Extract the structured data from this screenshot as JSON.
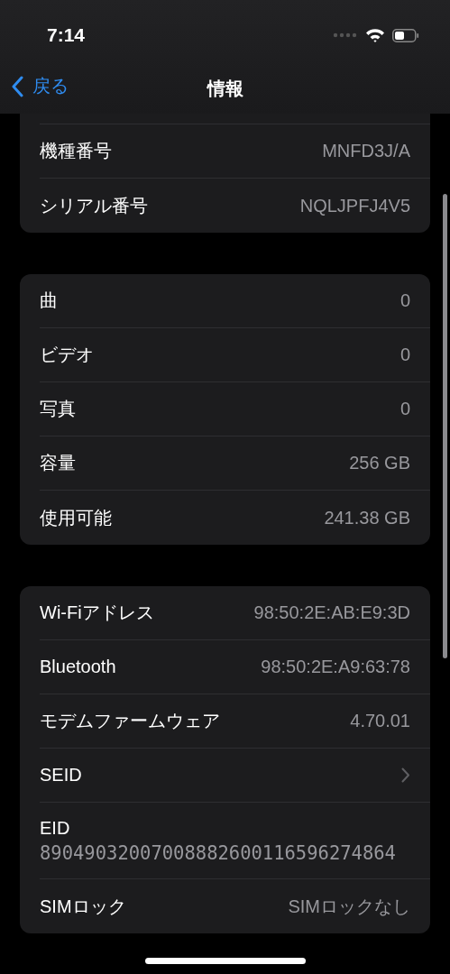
{
  "status_bar": {
    "time": "7:14"
  },
  "nav": {
    "back": "戻る",
    "title": "情報"
  },
  "groups": [
    {
      "clipped_top": true,
      "rows": [
        {
          "kind": "value",
          "label": "機種番号",
          "value": "MNFD3J/A"
        },
        {
          "kind": "value",
          "label": "シリアル番号",
          "value": "NQLJPFJ4V5"
        }
      ]
    },
    {
      "clipped_top": false,
      "rows": [
        {
          "kind": "value",
          "label": "曲",
          "value": "0"
        },
        {
          "kind": "value",
          "label": "ビデオ",
          "value": "0"
        },
        {
          "kind": "value",
          "label": "写真",
          "value": "0"
        },
        {
          "kind": "value",
          "label": "容量",
          "value": "256 GB"
        },
        {
          "kind": "value",
          "label": "使用可能",
          "value": "241.38 GB"
        }
      ]
    },
    {
      "clipped_top": false,
      "rows": [
        {
          "kind": "value",
          "label": "Wi-Fiアドレス",
          "value": "98:50:2E:AB:E9:3D"
        },
        {
          "kind": "value",
          "label": "Bluetooth",
          "value": "98:50:2E:A9:63:78"
        },
        {
          "kind": "value",
          "label": "モデムファームウェア",
          "value": "4.70.01"
        },
        {
          "kind": "link",
          "label": "SEID"
        },
        {
          "kind": "stacked",
          "label": "EID",
          "value": "89049032007008882600116596274864"
        },
        {
          "kind": "value",
          "label": "SIMロック",
          "value": "SIMロックなし"
        }
      ]
    }
  ]
}
